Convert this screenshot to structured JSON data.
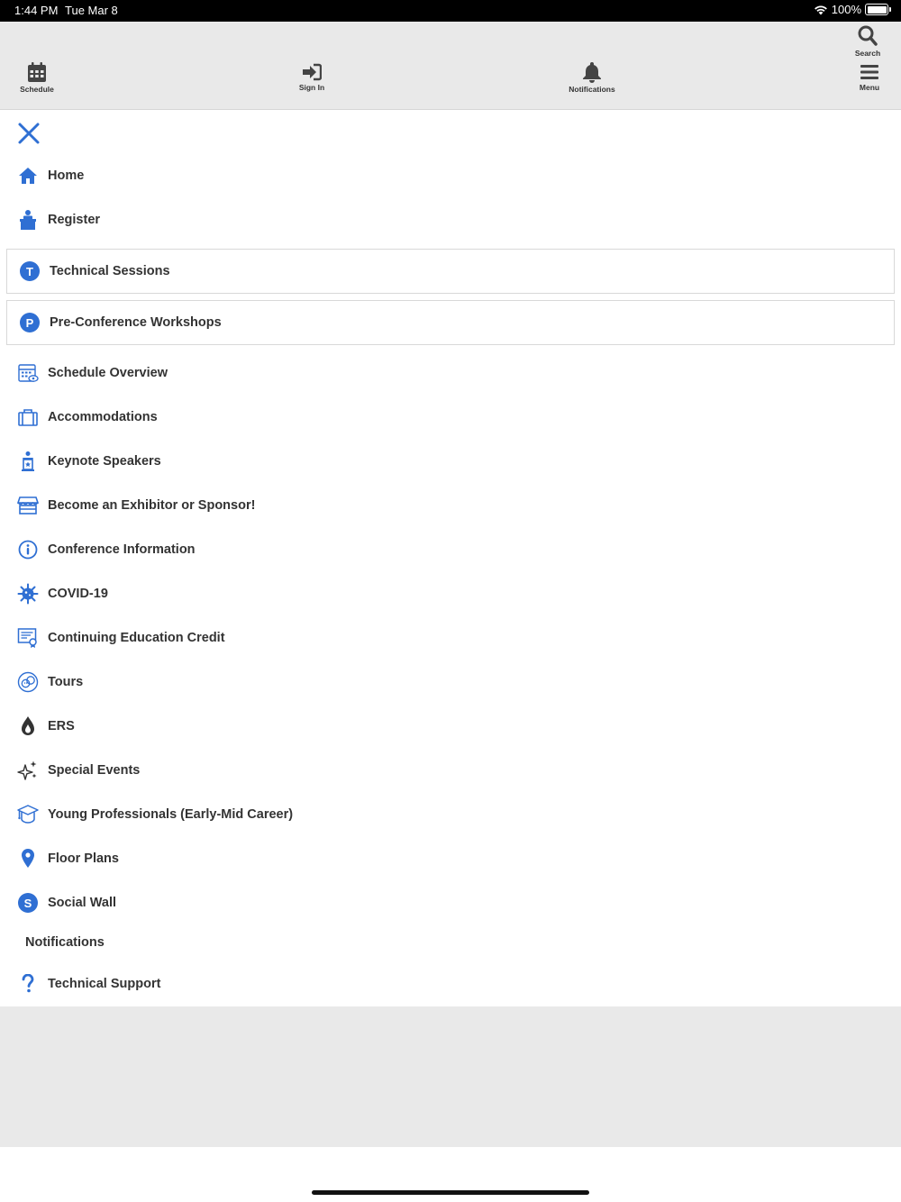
{
  "status_bar": {
    "time": "1:44 PM",
    "date": "Tue Mar 8",
    "battery": "100%"
  },
  "toolbar": {
    "schedule": "Schedule",
    "sign_in": "Sign In",
    "notifications": "Notifications",
    "search": "Search",
    "menu": "Menu"
  },
  "menu": {
    "items": [
      {
        "label": "Home",
        "icon": "home-icon"
      },
      {
        "label": "Register",
        "icon": "register-desk-icon"
      },
      {
        "label": "Technical Sessions",
        "icon": "letter-t-icon",
        "letter": "T"
      },
      {
        "label": "Pre-Conference Workshops",
        "icon": "letter-p-icon",
        "letter": "P"
      },
      {
        "label": "Schedule Overview",
        "icon": "calendar-eye-icon"
      },
      {
        "label": "Accommodations",
        "icon": "suitcase-icon"
      },
      {
        "label": "Keynote Speakers",
        "icon": "podium-icon"
      },
      {
        "label": "Become an Exhibitor or Sponsor!",
        "icon": "storefront-icon"
      },
      {
        "label": "Conference Information",
        "icon": "info-icon"
      },
      {
        "label": "COVID-19",
        "icon": "virus-icon"
      },
      {
        "label": "Continuing Education Credit",
        "icon": "certificate-icon"
      },
      {
        "label": "Tours",
        "icon": "tours-icon"
      },
      {
        "label": "ERS",
        "icon": "flame-drop-icon"
      },
      {
        "label": "Special Events",
        "icon": "sparkles-icon"
      },
      {
        "label": "Young Professionals (Early-Mid Career)",
        "icon": "graduation-cap-icon"
      },
      {
        "label": "Floor Plans",
        "icon": "map-pin-icon"
      },
      {
        "label": "Social Wall",
        "icon": "letter-s-icon",
        "letter": "S"
      },
      {
        "label": "Notifications"
      },
      {
        "label": "Technical Support",
        "icon": "question-icon"
      }
    ]
  },
  "colors": {
    "accent": "#2f6fd3",
    "toolbar_bg": "#e9e9e9",
    "text": "#333333"
  }
}
